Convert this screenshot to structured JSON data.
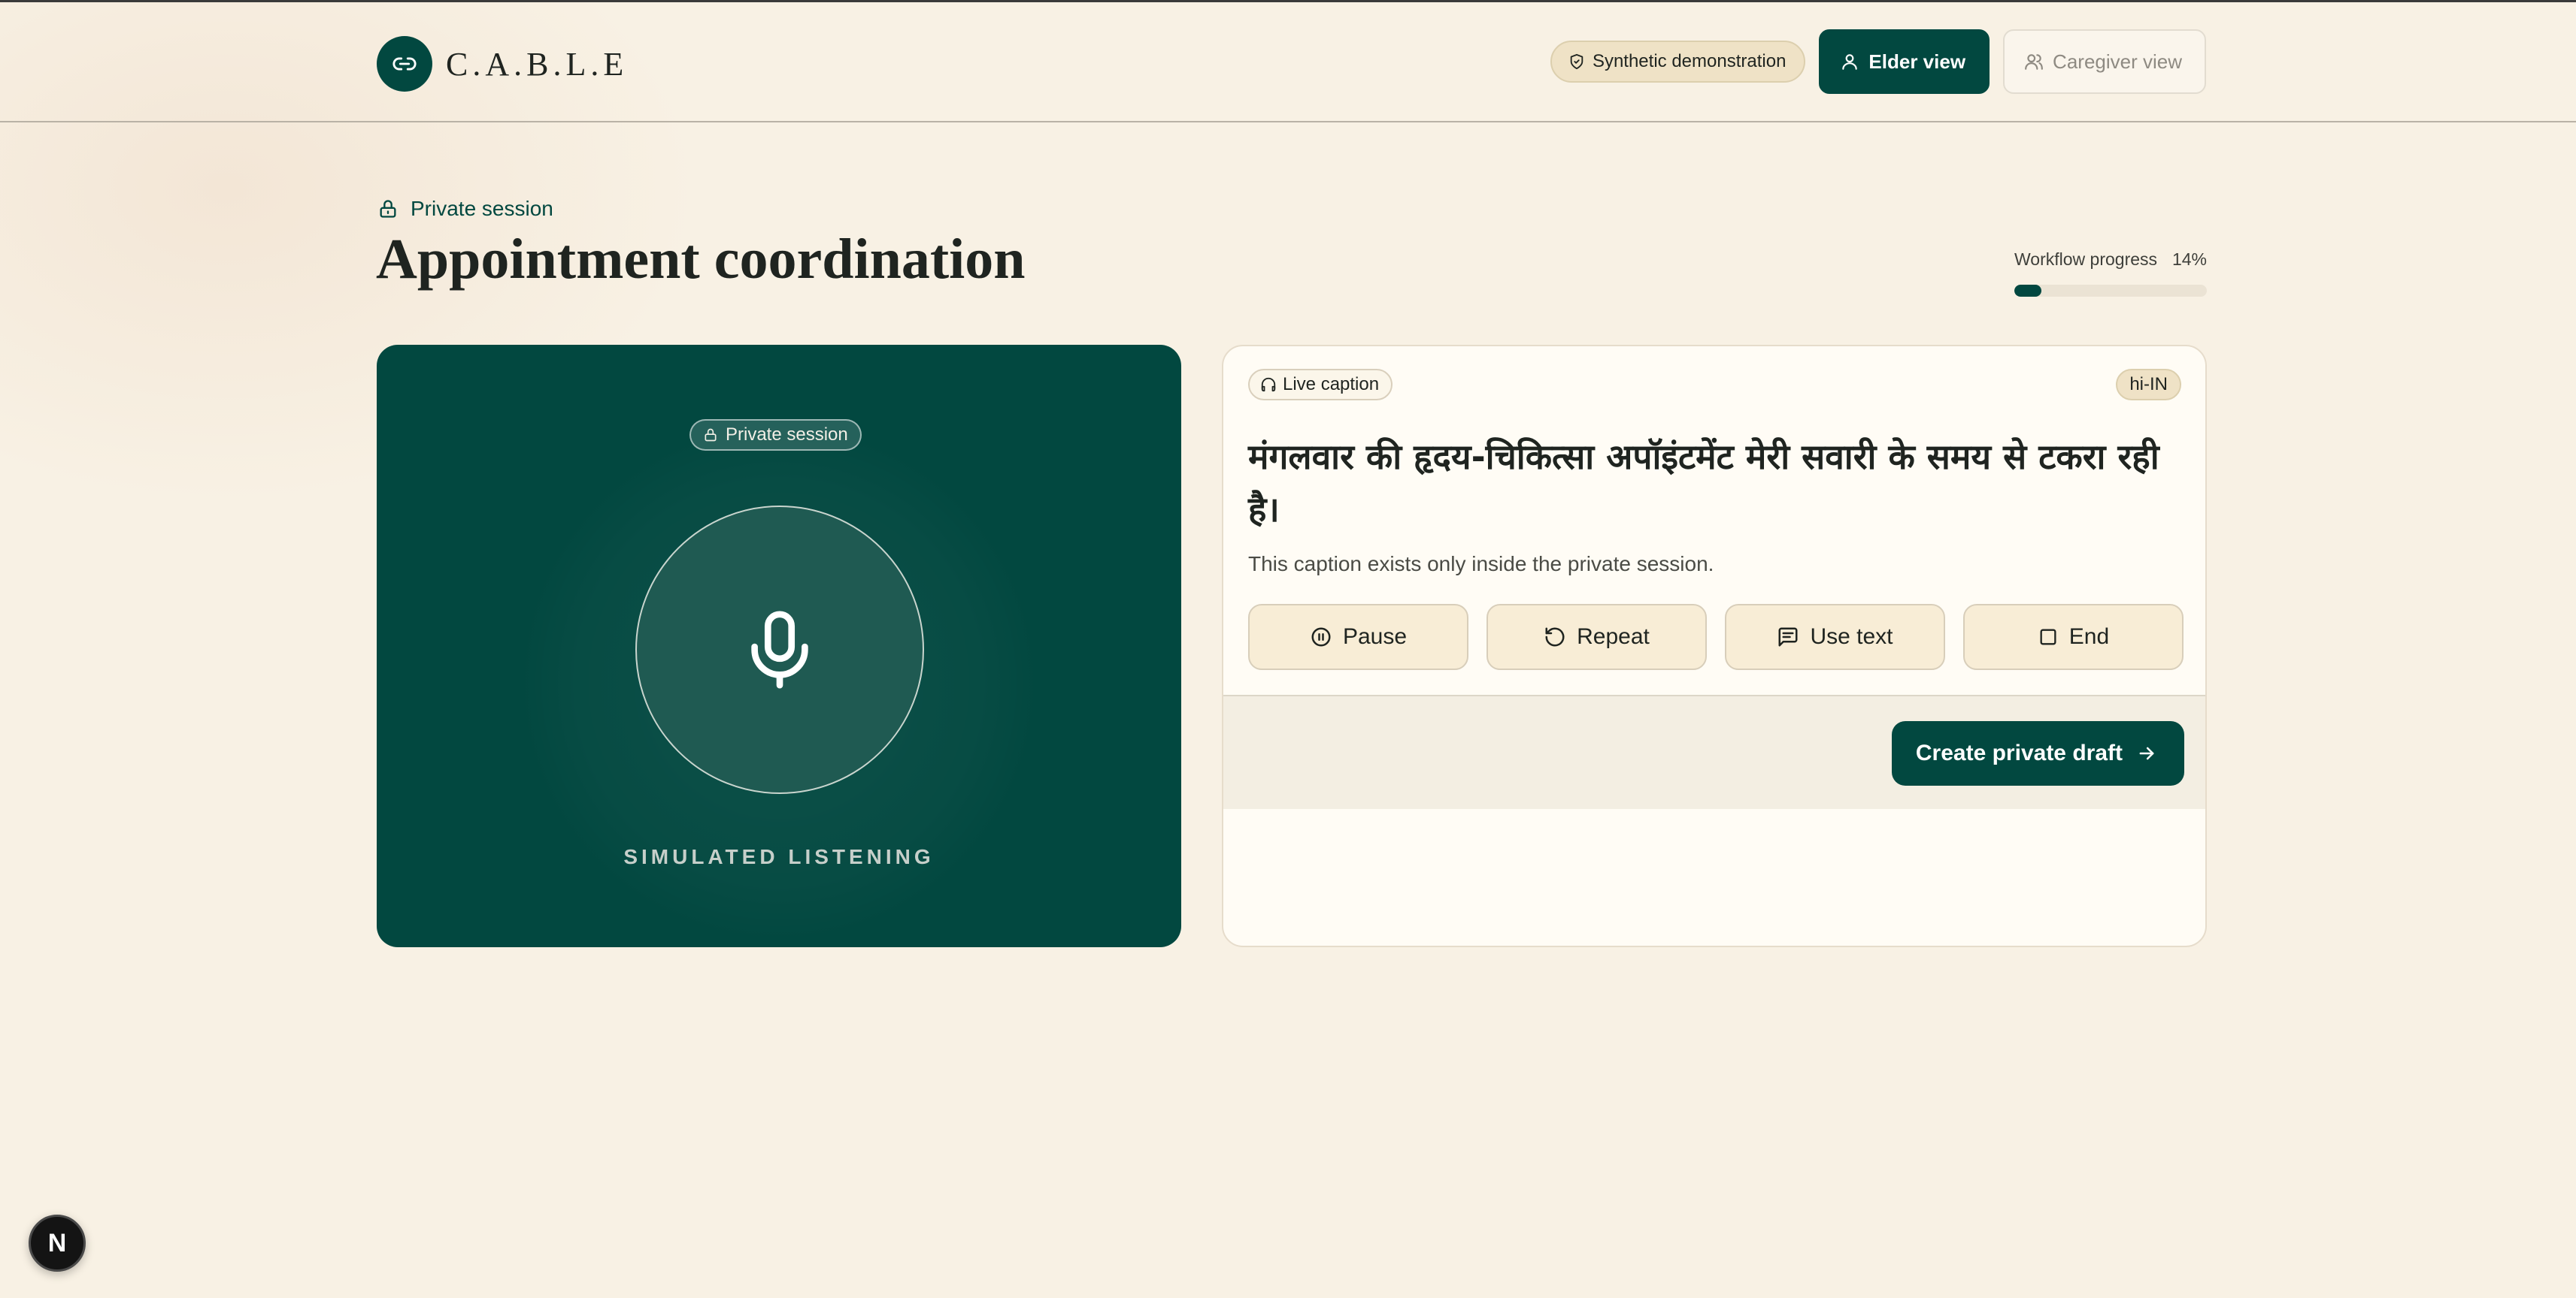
{
  "app": {
    "name": "C.A.B.L.E"
  },
  "header": {
    "demo_badge": "Synthetic demonstration",
    "elder_view": "Elder view",
    "caregiver_view": "Caregiver view"
  },
  "session": {
    "label": "Private session",
    "title": "Appointment coordination"
  },
  "progress": {
    "label": "Workflow progress",
    "value_text": "14%",
    "value": 0.14
  },
  "listening_panel": {
    "badge": "Private session",
    "status": "SIMULATED LISTENING"
  },
  "caption_panel": {
    "badge": "Live caption",
    "language": "hi-IN",
    "text": "मंगलवार की हृदय-चिकित्सा अपॉइंटमेंट मेरी सवारी के समय से टकरा रही है।",
    "note": "This caption exists only inside the private session.",
    "controls": {
      "pause": "Pause",
      "repeat": "Repeat",
      "use_text": "Use text",
      "end": "End"
    },
    "draft_button": "Create private draft"
  },
  "dev_badge": "N",
  "colors": {
    "primary": "#024840",
    "background": "#f8f1e4",
    "accent_badge": "#efe2c6"
  },
  "icons": {
    "logo": "link-icon",
    "demo": "shield-check-icon",
    "elder": "user-icon",
    "caregiver": "users-icon",
    "session": "lock-icon",
    "mic": "microphone-icon",
    "caption": "headphones-icon",
    "pause": "pause-circle-icon",
    "repeat": "rotate-ccw-icon",
    "use_text": "message-text-icon",
    "end": "square-icon",
    "draft": "arrow-right-icon"
  }
}
